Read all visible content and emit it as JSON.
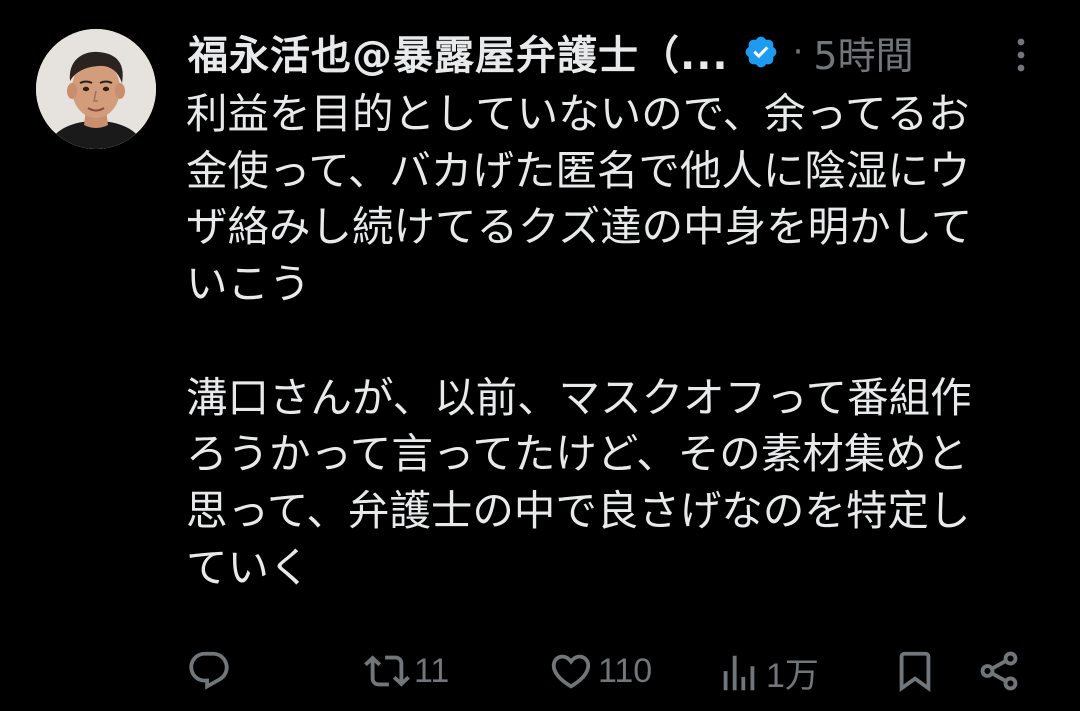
{
  "author": {
    "display_name": "福永活也@暴露屋弁護士（...",
    "verified": true
  },
  "meta": {
    "separator": "·",
    "time_ago": "5時間"
  },
  "body": {
    "paragraph1": [
      "利益を目的としていないので、余ってるお",
      "金使って、バカげた匿名で他人に陰湿にウ",
      "ザ絡みし続けてるクズ達の中身を明かして",
      "いこう"
    ],
    "paragraph2": [
      "溝口さんが、以前、マスクオフって番組作",
      "ろうかって言ってたけど、その素材集めと",
      "思って、弁護士の中で良さげなのを特定し",
      "ていく"
    ]
  },
  "actions": {
    "reply": {
      "icon": "reply-icon",
      "count": ""
    },
    "retweet": {
      "icon": "retweet-icon",
      "count": "11"
    },
    "like": {
      "icon": "heart-icon",
      "count": "110"
    },
    "views": {
      "icon": "views-icon",
      "count": "1万"
    },
    "bookmark": {
      "icon": "bookmark-icon"
    },
    "share": {
      "icon": "share-icon"
    }
  },
  "colors": {
    "background": "#000000",
    "text_primary": "#e7e9ea",
    "text_secondary": "#71767b",
    "verified_badge": "#1d9bf0"
  }
}
